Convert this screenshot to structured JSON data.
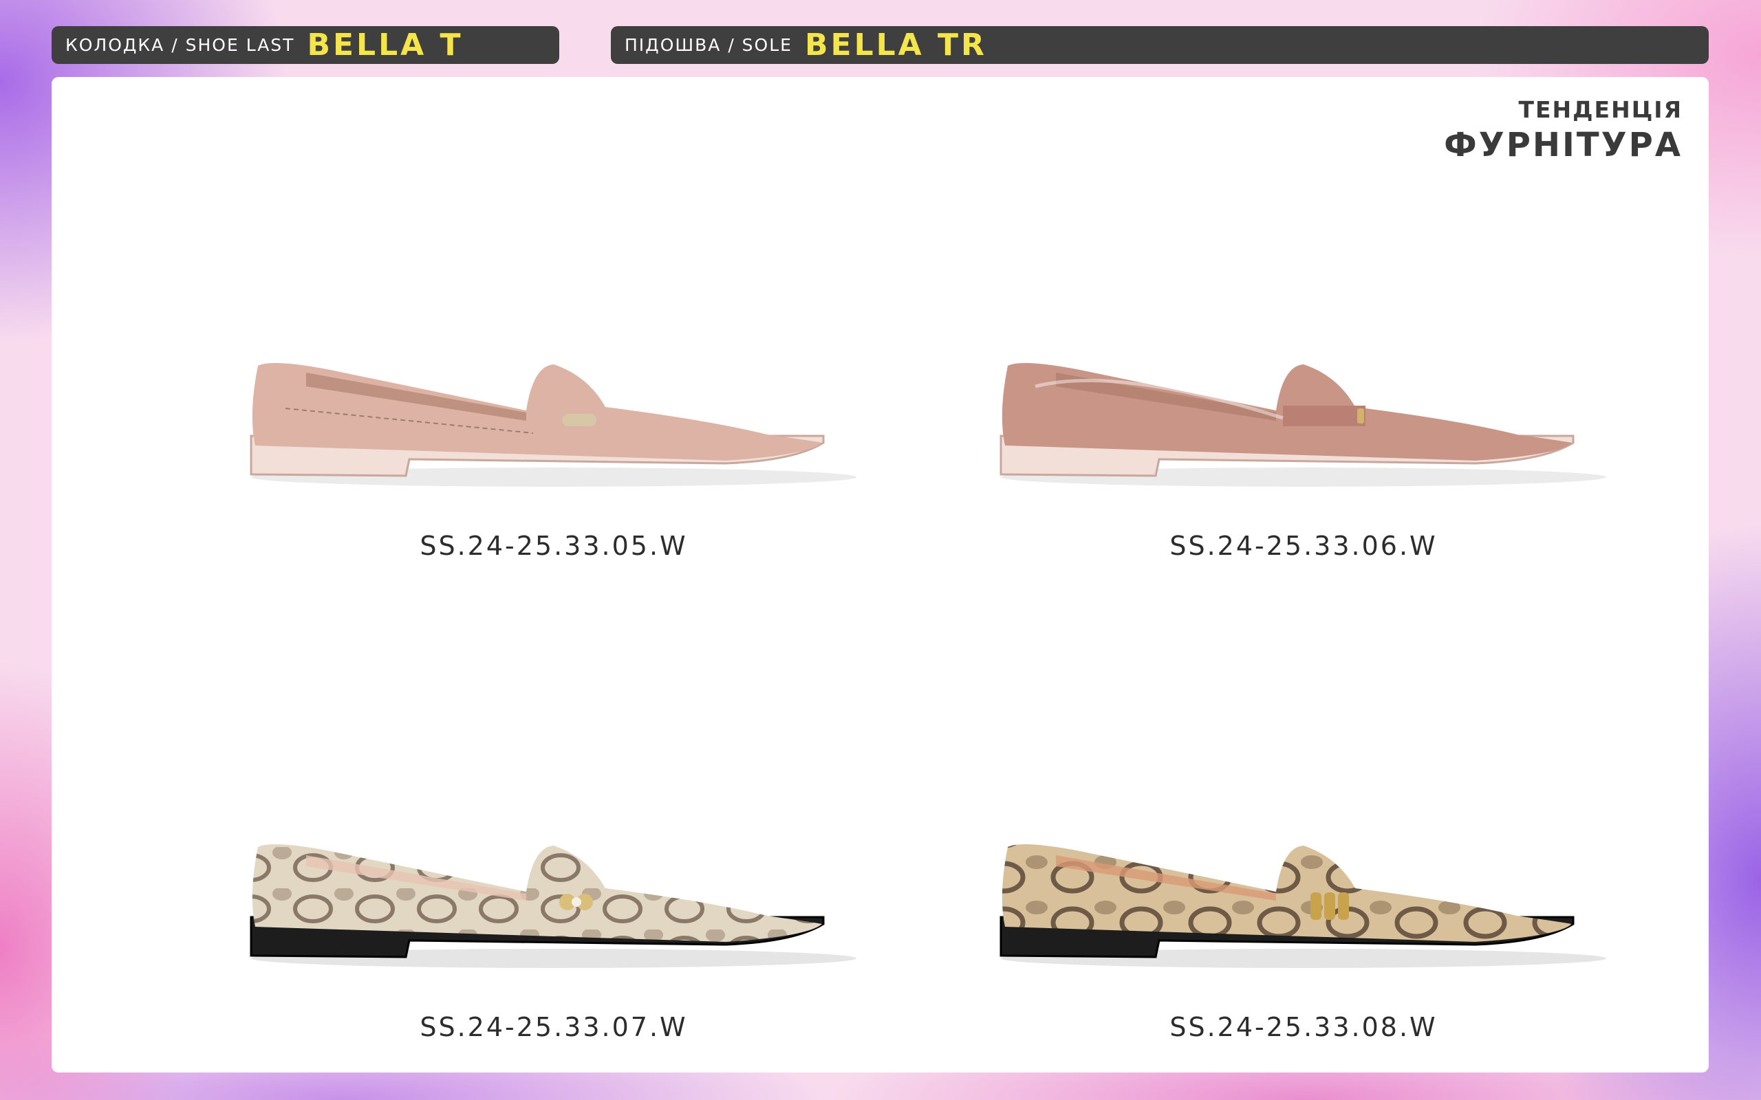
{
  "header": {
    "last_label": "КОЛОДКА / SHOE LAST",
    "last_value": "BELLA T",
    "sole_label": "ПІДОШВА / SOLE",
    "sole_value": "BELLA TR"
  },
  "trend": {
    "label": "ТЕНДЕНЦІЯ",
    "value": "ФУРНІТУРА"
  },
  "products": [
    {
      "code": "SS.24-25.33.05.W",
      "upper": "#dcb3a4",
      "sole": "#f1dfd8",
      "sole_edge": "#c9a79c",
      "hardware": "#d8c7a6"
    },
    {
      "code": "SS.24-25.33.06.W",
      "upper": "#c99587",
      "sole": "#f1dfd8",
      "sole_edge": "#c9a79c",
      "hardware": "#d3b26b"
    },
    {
      "code": "SS.24-25.33.07.W",
      "upper": "#e2d7c2",
      "sole": "#1d1d1d",
      "sole_edge": "#000000",
      "hardware": "#d9bf7a"
    },
    {
      "code": "SS.24-25.33.08.W",
      "upper": "#d8c09a",
      "sole": "#1d1d1d",
      "sole_edge": "#000000",
      "hardware": "#c9a24c"
    }
  ]
}
